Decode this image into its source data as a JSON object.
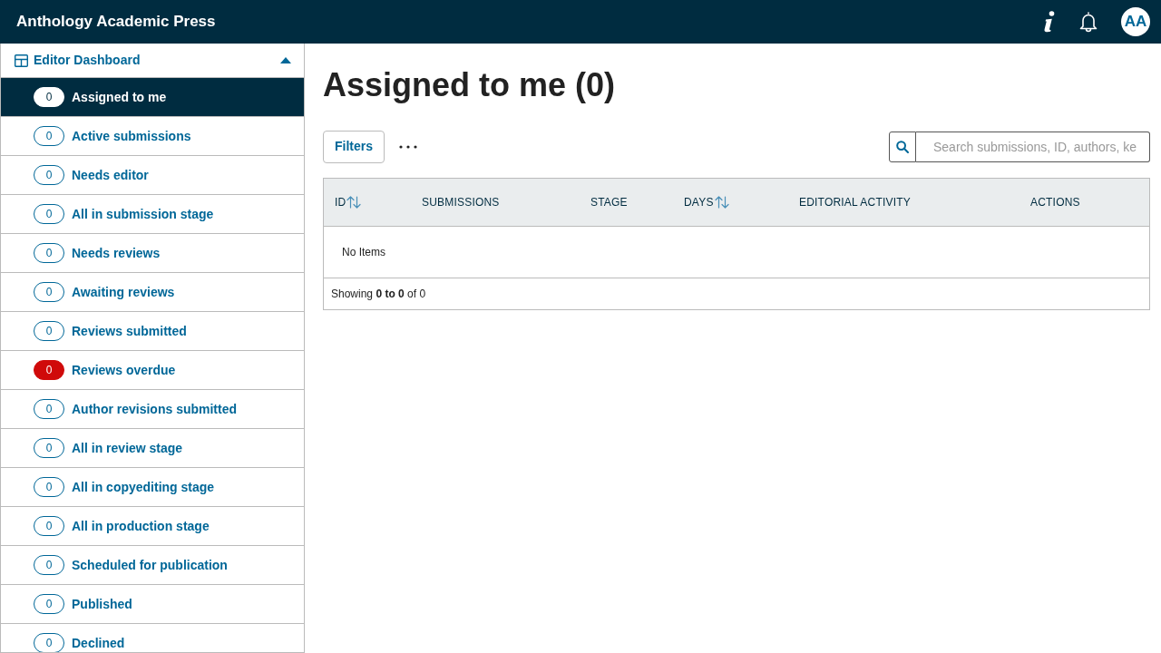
{
  "header": {
    "title": "Anthology Academic Press",
    "avatar_initials": "AA"
  },
  "sidebar": {
    "title": "Editor Dashboard",
    "expanded": true,
    "items": [
      {
        "label": "Assigned to me",
        "count": "0",
        "kind": "normal",
        "selected": true
      },
      {
        "label": "Active submissions",
        "count": "0",
        "kind": "normal",
        "selected": false
      },
      {
        "label": "Needs editor",
        "count": "0",
        "kind": "normal",
        "selected": false
      },
      {
        "label": "All in submission stage",
        "count": "0",
        "kind": "normal",
        "selected": false
      },
      {
        "label": "Needs reviews",
        "count": "0",
        "kind": "normal",
        "selected": false
      },
      {
        "label": "Awaiting reviews",
        "count": "0",
        "kind": "normal",
        "selected": false
      },
      {
        "label": "Reviews submitted",
        "count": "0",
        "kind": "normal",
        "selected": false
      },
      {
        "label": "Reviews overdue",
        "count": "0",
        "kind": "alert",
        "selected": false
      },
      {
        "label": "Author revisions submitted",
        "count": "0",
        "kind": "normal",
        "selected": false
      },
      {
        "label": "All in review stage",
        "count": "0",
        "kind": "normal",
        "selected": false
      },
      {
        "label": "All in copyediting stage",
        "count": "0",
        "kind": "normal",
        "selected": false
      },
      {
        "label": "All in production stage",
        "count": "0",
        "kind": "normal",
        "selected": false
      },
      {
        "label": "Scheduled for publication",
        "count": "0",
        "kind": "normal",
        "selected": false
      },
      {
        "label": "Published",
        "count": "0",
        "kind": "normal",
        "selected": false
      },
      {
        "label": "Declined",
        "count": "0",
        "kind": "normal",
        "selected": false
      }
    ]
  },
  "main": {
    "title": "Assigned to me (0)",
    "toolbar": {
      "filters_button": "Filters",
      "search": {
        "placeholder": "Search submissions, ID, authors, ke"
      }
    },
    "table": {
      "columns": [
        {
          "label": "ID",
          "sortable": true
        },
        {
          "label": "SUBMISSIONS",
          "sortable": false
        },
        {
          "label": "STAGE",
          "sortable": false
        },
        {
          "label": "DAYS",
          "sortable": true
        },
        {
          "label": "EDITORIAL ACTIVITY",
          "sortable": false
        },
        {
          "label": "ACTIONS",
          "sortable": false
        }
      ],
      "empty_message": "No Items",
      "footer": "Showing **0 to 0** of 0"
    }
  }
}
